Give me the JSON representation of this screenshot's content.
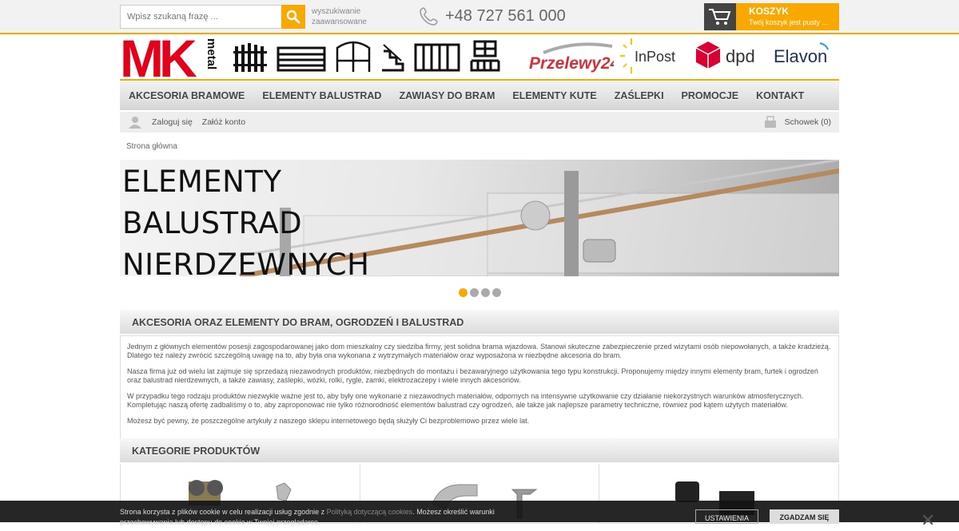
{
  "search": {
    "placeholder": "Wpisz szukaną frazę ...",
    "advanced_line1": "wyszukiwanie",
    "advanced_line2": "zaawansowane"
  },
  "phone": "+48 727 561 000",
  "cart": {
    "title": "KOSZYK",
    "status": "Twój koszyk jest pusty ..."
  },
  "logo": {
    "text": "MK",
    "sub": "metal"
  },
  "payments": [
    "Przelewy24",
    "InPost",
    "dpd",
    "Elavon"
  ],
  "nav": [
    "AKCESORIA BRAMOWE",
    "ELEMENTY BALUSTRAD",
    "ZAWIASY DO BRAM",
    "ELEMENTY KUTE",
    "ZAŚLEPKI",
    "PROMOCJE",
    "KONTAKT"
  ],
  "account": {
    "login": "Zaloguj się",
    "register": "Załóż konto",
    "clipboard": "Schowek (0)"
  },
  "breadcrumb": "Strona główna",
  "banner": {
    "line1": "ELEMENTY",
    "line2": "BALUSTRAD",
    "line3": "NIERDZEWNYCH",
    "slides": 4,
    "active_slide": 1
  },
  "about": {
    "title": "AKCESORIA ORAZ ELEMENTY DO BRAM, OGRODZEŃ I BALUSTRAD",
    "p1": "Jednym z głównych elementów posesji zagospodarowanej jako dom mieszkalny czy siedziba firmy, jest solidna brama wjazdowa. Stanowi skuteczne zabezpieczenie przed wizytami osób niepowołanych, a także kradzieżą. Dlatego też należy zwrócić szczególną uwagę na to, aby była ona wykonana z wytrzymałych materiałów oraz wyposażona w niezbędne akcesoria do bram.",
    "p2": "Nasza firma już od wielu lat zajmuje się sprzedażą niezawodnych produktów, niezbędnych do montażu i bezawaryjnego użytkowania tego typu konstrukcji. Proponujemy między innymi elementy bram, furtek i ogrodzeń oraz balustrad nierdzewnych, a także zawiasy, zaślepki, wózki, rolki, rygle, zamki, elektrozaczepy i wiele innych akcesoriów.",
    "p3": "W przypadku tego rodzaju produktów niezwykle ważne jest to, aby były one wykonane z niezawodnych materiałów, odpornych na intensywne użytkowanie czy działanie niekorzystnych warunków atmosferycznych. Kompletując naszą ofertę zadbaliśmy o to, aby zaproponować nie tylko różnorodność elementów balustrad czy ogrodzeń, ale także jak najlepsze parametry techniczne, również pod kątem użytych materiałów.",
    "p4": "Możesz być pewny, że poszczególne artykuły z naszego sklepu internetowego będą służyły Ci bezproblemowo przez wiele lat."
  },
  "categories": {
    "title": "KATEGORIE PRODUKTÓW"
  },
  "cookie": {
    "text1": "Strona korzysta z plików cookie w celu realizacji usług zgodnie z ",
    "link": "Polityką dotyczącą cookies",
    "text2": ". Możesz określić warunki przechowywania lub dostępu do cookie w Twojej przeglądarce.",
    "settings": "USTAWIENIA",
    "accept": "ZGADZAM SIĘ"
  },
  "colors": {
    "accent": "#f9a800",
    "logo_red": "#e3001b",
    "dpd_red": "#dc0032"
  }
}
